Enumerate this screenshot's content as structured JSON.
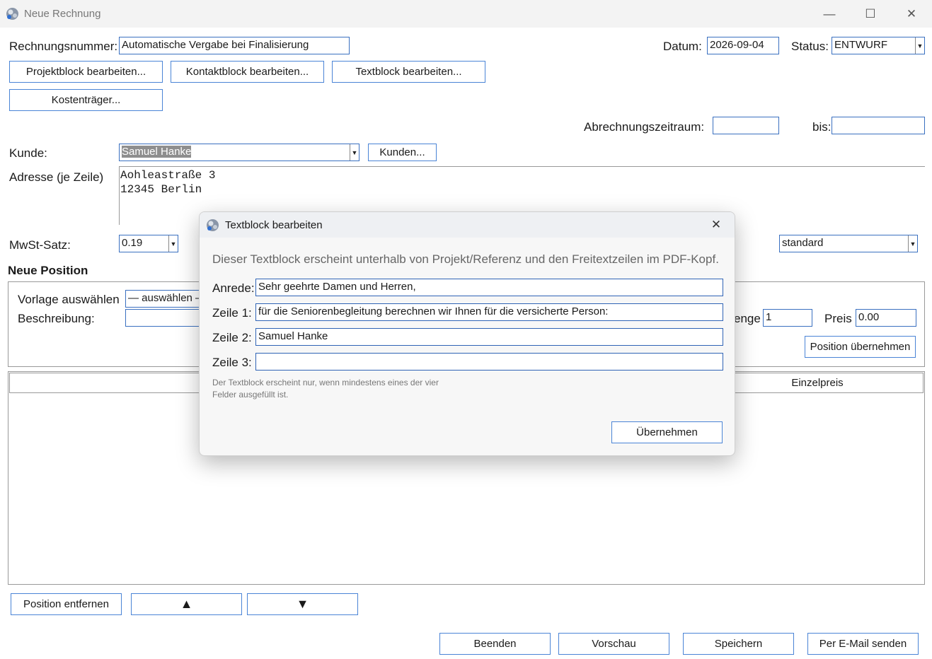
{
  "window": {
    "title": "Neue Rechnung"
  },
  "header": {
    "rechnungsnummer_label": "Rechnungsnummer:",
    "rechnungsnummer_value": "Automatische Vergabe bei Finalisierung",
    "datum_label": "Datum:",
    "datum_value": "2026-09-04",
    "status_label": "Status:",
    "status_value": "ENTWURF"
  },
  "buttons": {
    "projektblock": "Projektblock bearbeiten...",
    "kontaktblock": "Kontaktblock bearbeiten...",
    "textblock": "Textblock bearbeiten...",
    "kostentraeger": "Kostenträger...",
    "kunden": "Kunden...",
    "position_uebernehmen": "Position übernehmen",
    "position_entfernen": "Position entfernen",
    "up_symbol": "▲",
    "down_symbol": "▼",
    "beenden": "Beenden",
    "vorschau": "Vorschau",
    "speichern": "Speichern",
    "email": "Per E-Mail senden"
  },
  "period": {
    "label": "Abrechnungszeitraum:",
    "from_value": "",
    "to_label": "bis:",
    "to_value": ""
  },
  "customer": {
    "kunde_label": "Kunde:",
    "kunde_value": "Samuel Hanke",
    "adresse_label": "Adresse (je Zeile)",
    "adresse_line1": "Aohleastraße 3",
    "adresse_line2": "12345 Berlin"
  },
  "mwst": {
    "label": "MwSt-Satz:",
    "value": "0.19"
  },
  "template_select": {
    "value": "standard"
  },
  "new_position": {
    "section_title": "Neue Position",
    "vorlage_label": "Vorlage auswählen",
    "vorlage_value": "— auswählen —",
    "beschreibung_label": "Beschreibung:",
    "menge_label": "enge",
    "menge_value": "1",
    "preis_label": "Preis",
    "preis_value": "0.00"
  },
  "table": {
    "columns": [
      "Einzelpreis"
    ]
  },
  "dialog": {
    "title": "Textblock bearbeiten",
    "description": "Dieser Textblock erscheint unterhalb von Projekt/Referenz und den Freitextzeilen im PDF-Kopf.",
    "anrede_label": "Anrede:",
    "anrede_value": "Sehr geehrte Damen und Herren,",
    "zeile1_label": "Zeile 1:",
    "zeile1_value": "für die Seniorenbegleitung berechnen wir Ihnen für die versicherte Person:",
    "zeile2_label": "Zeile 2:",
    "zeile2_value": "Samuel Hanke",
    "zeile3_label": "Zeile 3:",
    "zeile3_value": "",
    "hint_line1": "Der Textblock erscheint nur, wenn mindestens eines der vier",
    "hint_line2": "Felder ausgefüllt ist.",
    "ok_button": "Übernehmen",
    "close_symbol": "✕"
  },
  "colors": {
    "accent": "#3a70c0",
    "selection": "#8e8e8e"
  }
}
